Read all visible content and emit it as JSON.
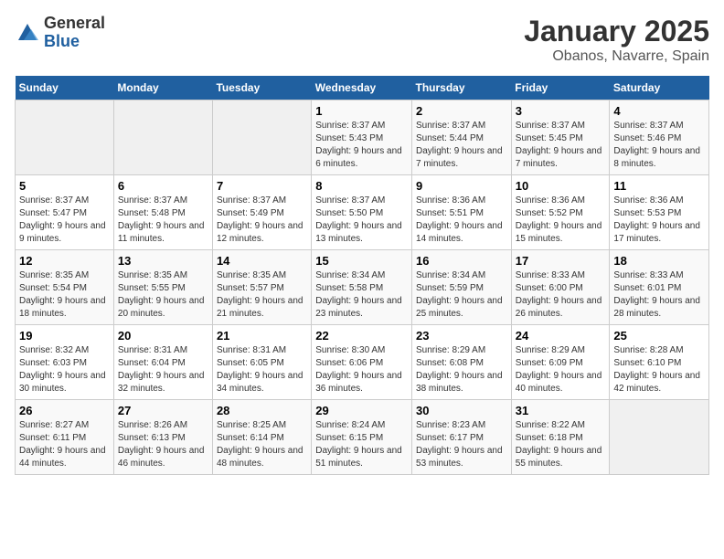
{
  "logo": {
    "general": "General",
    "blue": "Blue"
  },
  "title": "January 2025",
  "subtitle": "Obanos, Navarre, Spain",
  "weekdays": [
    "Sunday",
    "Monday",
    "Tuesday",
    "Wednesday",
    "Thursday",
    "Friday",
    "Saturday"
  ],
  "weeks": [
    [
      {
        "day": "",
        "info": ""
      },
      {
        "day": "",
        "info": ""
      },
      {
        "day": "",
        "info": ""
      },
      {
        "day": "1",
        "info": "Sunrise: 8:37 AM\nSunset: 5:43 PM\nDaylight: 9 hours and 6 minutes."
      },
      {
        "day": "2",
        "info": "Sunrise: 8:37 AM\nSunset: 5:44 PM\nDaylight: 9 hours and 7 minutes."
      },
      {
        "day": "3",
        "info": "Sunrise: 8:37 AM\nSunset: 5:45 PM\nDaylight: 9 hours and 7 minutes."
      },
      {
        "day": "4",
        "info": "Sunrise: 8:37 AM\nSunset: 5:46 PM\nDaylight: 9 hours and 8 minutes."
      }
    ],
    [
      {
        "day": "5",
        "info": "Sunrise: 8:37 AM\nSunset: 5:47 PM\nDaylight: 9 hours and 9 minutes."
      },
      {
        "day": "6",
        "info": "Sunrise: 8:37 AM\nSunset: 5:48 PM\nDaylight: 9 hours and 11 minutes."
      },
      {
        "day": "7",
        "info": "Sunrise: 8:37 AM\nSunset: 5:49 PM\nDaylight: 9 hours and 12 minutes."
      },
      {
        "day": "8",
        "info": "Sunrise: 8:37 AM\nSunset: 5:50 PM\nDaylight: 9 hours and 13 minutes."
      },
      {
        "day": "9",
        "info": "Sunrise: 8:36 AM\nSunset: 5:51 PM\nDaylight: 9 hours and 14 minutes."
      },
      {
        "day": "10",
        "info": "Sunrise: 8:36 AM\nSunset: 5:52 PM\nDaylight: 9 hours and 15 minutes."
      },
      {
        "day": "11",
        "info": "Sunrise: 8:36 AM\nSunset: 5:53 PM\nDaylight: 9 hours and 17 minutes."
      }
    ],
    [
      {
        "day": "12",
        "info": "Sunrise: 8:35 AM\nSunset: 5:54 PM\nDaylight: 9 hours and 18 minutes."
      },
      {
        "day": "13",
        "info": "Sunrise: 8:35 AM\nSunset: 5:55 PM\nDaylight: 9 hours and 20 minutes."
      },
      {
        "day": "14",
        "info": "Sunrise: 8:35 AM\nSunset: 5:57 PM\nDaylight: 9 hours and 21 minutes."
      },
      {
        "day": "15",
        "info": "Sunrise: 8:34 AM\nSunset: 5:58 PM\nDaylight: 9 hours and 23 minutes."
      },
      {
        "day": "16",
        "info": "Sunrise: 8:34 AM\nSunset: 5:59 PM\nDaylight: 9 hours and 25 minutes."
      },
      {
        "day": "17",
        "info": "Sunrise: 8:33 AM\nSunset: 6:00 PM\nDaylight: 9 hours and 26 minutes."
      },
      {
        "day": "18",
        "info": "Sunrise: 8:33 AM\nSunset: 6:01 PM\nDaylight: 9 hours and 28 minutes."
      }
    ],
    [
      {
        "day": "19",
        "info": "Sunrise: 8:32 AM\nSunset: 6:03 PM\nDaylight: 9 hours and 30 minutes."
      },
      {
        "day": "20",
        "info": "Sunrise: 8:31 AM\nSunset: 6:04 PM\nDaylight: 9 hours and 32 minutes."
      },
      {
        "day": "21",
        "info": "Sunrise: 8:31 AM\nSunset: 6:05 PM\nDaylight: 9 hours and 34 minutes."
      },
      {
        "day": "22",
        "info": "Sunrise: 8:30 AM\nSunset: 6:06 PM\nDaylight: 9 hours and 36 minutes."
      },
      {
        "day": "23",
        "info": "Sunrise: 8:29 AM\nSunset: 6:08 PM\nDaylight: 9 hours and 38 minutes."
      },
      {
        "day": "24",
        "info": "Sunrise: 8:29 AM\nSunset: 6:09 PM\nDaylight: 9 hours and 40 minutes."
      },
      {
        "day": "25",
        "info": "Sunrise: 8:28 AM\nSunset: 6:10 PM\nDaylight: 9 hours and 42 minutes."
      }
    ],
    [
      {
        "day": "26",
        "info": "Sunrise: 8:27 AM\nSunset: 6:11 PM\nDaylight: 9 hours and 44 minutes."
      },
      {
        "day": "27",
        "info": "Sunrise: 8:26 AM\nSunset: 6:13 PM\nDaylight: 9 hours and 46 minutes."
      },
      {
        "day": "28",
        "info": "Sunrise: 8:25 AM\nSunset: 6:14 PM\nDaylight: 9 hours and 48 minutes."
      },
      {
        "day": "29",
        "info": "Sunrise: 8:24 AM\nSunset: 6:15 PM\nDaylight: 9 hours and 51 minutes."
      },
      {
        "day": "30",
        "info": "Sunrise: 8:23 AM\nSunset: 6:17 PM\nDaylight: 9 hours and 53 minutes."
      },
      {
        "day": "31",
        "info": "Sunrise: 8:22 AM\nSunset: 6:18 PM\nDaylight: 9 hours and 55 minutes."
      },
      {
        "day": "",
        "info": ""
      }
    ]
  ]
}
